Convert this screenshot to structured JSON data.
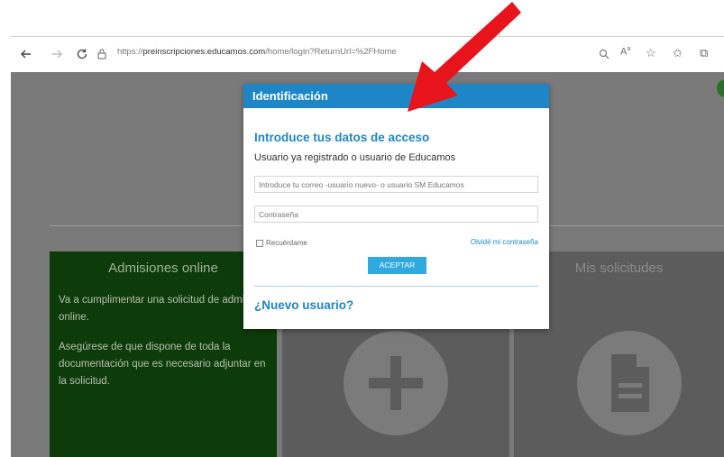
{
  "browser": {
    "url_prefix": "https://",
    "url_domain": "preinscripciones.educamos.com",
    "url_path": "/home/login?ReturnUrl=%2FHome",
    "right_icons": [
      "search-icon",
      "read-aloud-icon",
      "add-favorite-icon",
      "favorites-icon",
      "collections-icon"
    ]
  },
  "modal": {
    "header": "Identificación",
    "title": "Introduce tus datos de acceso",
    "subtitle": "Usuario ya registrado o usuario de Educamos",
    "user_placeholder": "Introduce tu correo -usuario nuevo- o usuario SM Educamos",
    "password_placeholder": "Contraseña",
    "remember_label": "Recuérdame",
    "forgot_label": "Olvidé mi contraseña",
    "accept_label": "ACEPTAR",
    "new_user_label": "¿Nuevo usuario?"
  },
  "cards": {
    "admissions_title": "Admisiones online",
    "admissions_text1": "Va a cumplimentar una solicitud de admisión online.",
    "admissions_text2": "Asegúrese de que dispone de toda la documentación que es necesario adjuntar en la solicitud.",
    "requests_title": "Mis solicitudes"
  },
  "colors": {
    "accent": "#1e86c6",
    "button": "#2fa9e0",
    "arrow": "#e8141b",
    "green_card": "#0e3b0a"
  }
}
